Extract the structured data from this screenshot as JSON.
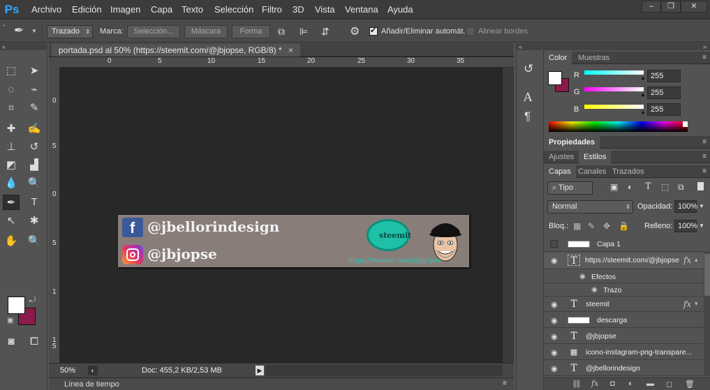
{
  "app": {
    "logo": "Ps"
  },
  "menu": [
    "Archivo",
    "Edición",
    "Imagen",
    "Capa",
    "Texto",
    "Selección",
    "Filtro",
    "3D",
    "Vista",
    "Ventana",
    "Ayuda"
  ],
  "options": {
    "mode": "Trazado",
    "marca_label": "Marca:",
    "seleccion": "Selección...",
    "mascara": "Máscara",
    "forma": "Forma",
    "auto_add": "Añadir/Eliminar automát.",
    "auto_add_checked": true,
    "align_edges": "Alinear bordes",
    "align_edges_checked": false
  },
  "document": {
    "tab_title": "portada.psd al 50% (https://steemit.com/@jbjopse, RGB/8) *",
    "ruler_h": [
      "0",
      "5",
      "10",
      "15",
      "20",
      "25",
      "30",
      "35"
    ],
    "ruler_v": [
      "0",
      "5",
      "0",
      "5",
      "1",
      "1 5"
    ],
    "zoom": "50%",
    "doc_info": "Doc: 455,2 KB/2,53 MB"
  },
  "artwork": {
    "handle_fb": "@jbellorindesign",
    "handle_ig": "@jbjopse",
    "steemit_word": "steemit",
    "url": "https://steemit.com/@jbjopse"
  },
  "timeline": {
    "label": "Línea de tiempo"
  },
  "colors": {
    "foreground": "#ffffff",
    "background": "#8a1b4b",
    "accent": "#31a8ff"
  },
  "color_panel": {
    "tabs": [
      "Color",
      "Muestras"
    ],
    "channels": [
      {
        "label": "R",
        "value": "255"
      },
      {
        "label": "G",
        "value": "255"
      },
      {
        "label": "B",
        "value": "255"
      }
    ]
  },
  "propiedades": {
    "title": "Propiedades"
  },
  "adjust_tabs": [
    "Ajustes",
    "Estilos"
  ],
  "layers_panel": {
    "tabs": [
      "Capas",
      "Canales",
      "Trazados"
    ],
    "filter": "Tipo",
    "blend": "Normal",
    "opacity_label": "Opacidad:",
    "opacity": "100%",
    "lock_label": "Bloq.:",
    "fill_label": "Relleno:",
    "fill": "100%",
    "layers": [
      {
        "name": "Capa 1",
        "kind": "image",
        "visible": false,
        "fx": false
      },
      {
        "name": "https://steemit.com/@jbjopse",
        "kind": "text",
        "visible": true,
        "fx": true,
        "selected": true
      },
      {
        "name": "Efectos",
        "kind": "sub",
        "visible": true
      },
      {
        "name": "Trazo",
        "kind": "subsub",
        "visible": true
      },
      {
        "name": "steemit",
        "kind": "text",
        "visible": true,
        "fx": true
      },
      {
        "name": "descarga",
        "kind": "image",
        "visible": true,
        "fx": false
      },
      {
        "name": "@jbjopse",
        "kind": "text",
        "visible": true,
        "fx": false
      },
      {
        "name": "icono-instagram-png-transpare...",
        "kind": "smart",
        "visible": true,
        "fx": false
      },
      {
        "name": "@jbellorindesign",
        "kind": "text",
        "visible": true,
        "fx": false
      }
    ],
    "fx_glyph": "fx"
  }
}
